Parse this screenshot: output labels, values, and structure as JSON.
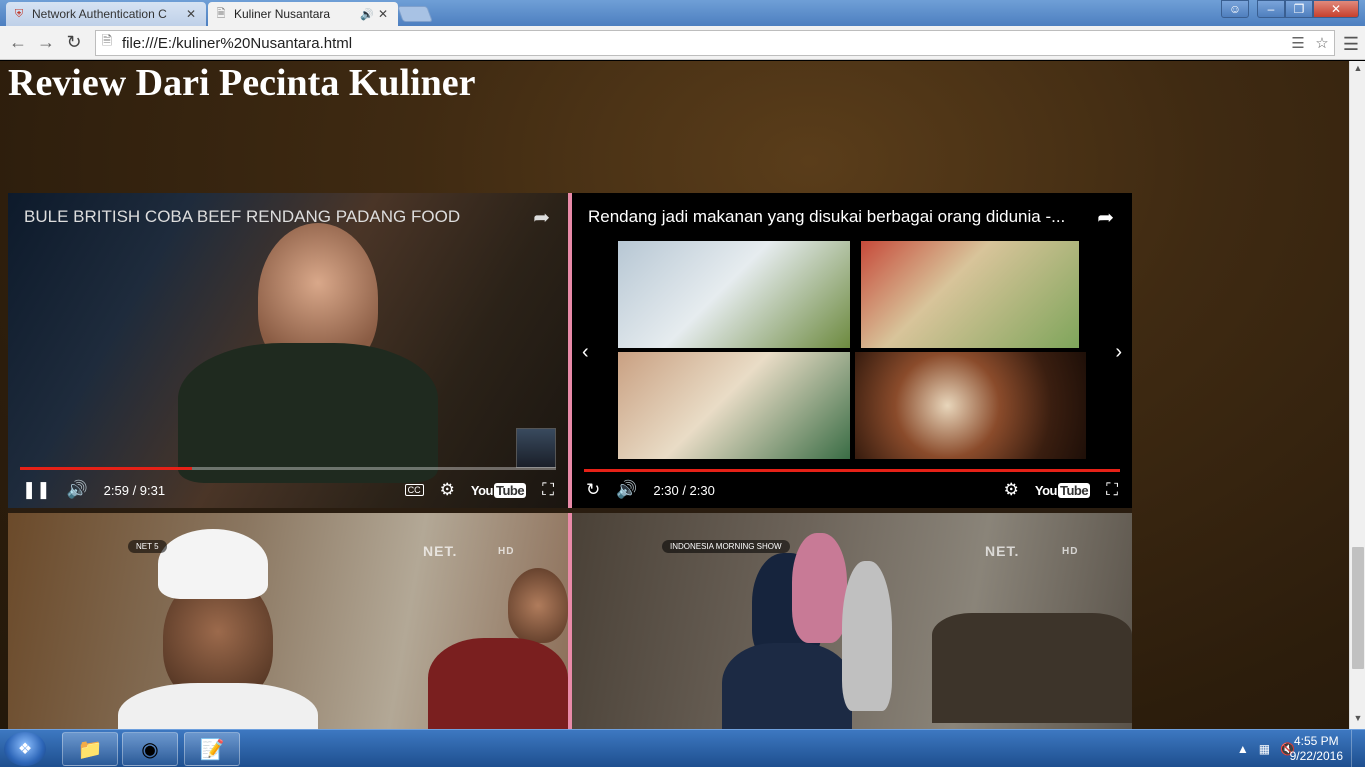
{
  "browser": {
    "tabs": [
      {
        "title": "Network Authentication C",
        "active": false
      },
      {
        "title": "Kuliner Nusantara",
        "active": true
      }
    ],
    "url": "file:///E:/kuliner%20Nusantara.html"
  },
  "page": {
    "heading": "Review Dari Pecinta Kuliner"
  },
  "videos": [
    {
      "title": "BULE BRITISH COBA BEEF RENDANG PADANG FOOD",
      "time": "2:59 / 9:31",
      "progress": 0.32
    },
    {
      "title": "Rendang jadi makanan yang disukai berbagai orang didunia -...",
      "time": "2:30 / 2:30",
      "progress": 1.0
    },
    {
      "show_tag": "NET 5",
      "logo": "NET.",
      "hd": "HD"
    },
    {
      "show_tag": "INDONESIA MORNING SHOW",
      "logo": "NET.",
      "hd": "HD"
    }
  ],
  "youtube": {
    "label_you": "You",
    "label_tube": "Tube"
  },
  "cc_label": "CC",
  "taskbar": {
    "time": "4:55 PM",
    "date": "9/22/2016"
  }
}
